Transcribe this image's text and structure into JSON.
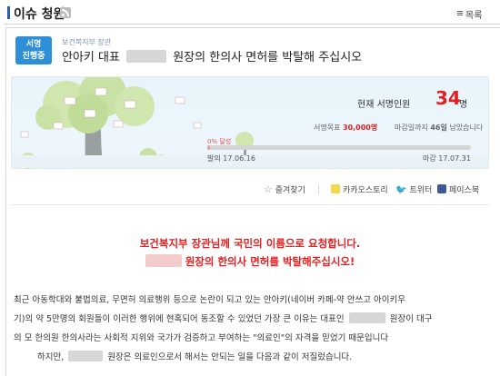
{
  "header": {
    "title": "이슈 청원",
    "list_label": "목록"
  },
  "badge": {
    "line1": "서명",
    "line2": "진행중"
  },
  "petition": {
    "ministry": "보건복지부 장관",
    "title_prefix": "안아키 대표",
    "title_suffix": "원장의 한의사 면허를 박탈해 주십시오"
  },
  "stats": {
    "count_label": "현재 서명인원",
    "count": "34",
    "count_unit": "명",
    "goal_label": "서명목표",
    "goal_value": "30,000명",
    "deadline_label": "마감일까지",
    "deadline_days": "46일",
    "deadline_suffix": "남았습니다",
    "percent_text": "0% 달성",
    "progress_fraction": 0.0011,
    "start_label": "발의",
    "start_date": "17.06.16",
    "end_label": "마감",
    "end_date": "17.07.31"
  },
  "share": {
    "favorite": "즐겨찾기",
    "kakao": "카카오스토리",
    "twitter": "트위터",
    "facebook": "페이스북"
  },
  "content": {
    "heading1": "보건복지부 장관님께 국민의 이름으로 요청합니다.",
    "heading2": "원장의 한의사 면허를 박탈해주십시오!",
    "line1": "최근 아동학대와 불법의료, 무면허 의료행위 등으로 논란이 되고 있는 안아키(네이버 카페-약 안쓰고 아이키우",
    "line2a": "기)의 약 5만명의 회원들이 이러한 행위에 현혹되어 동조할 수 있었던 가장 큰 이유는 대표인",
    "line2b": "원장이 대구",
    "line3": "의 모 한의원 한의사라는 사회적 지위와 국가가 검증하고 부여하는 \"의료인\"의 자격을 믿었기 때문입니다",
    "line4a": "하지만,",
    "line4b": "원장은 의료인으로서 해서는 안되는 일을 다음과 같이 저질렀습니다."
  },
  "colors": {
    "accent": "#2e8fd6",
    "highlight": "#e02020"
  }
}
